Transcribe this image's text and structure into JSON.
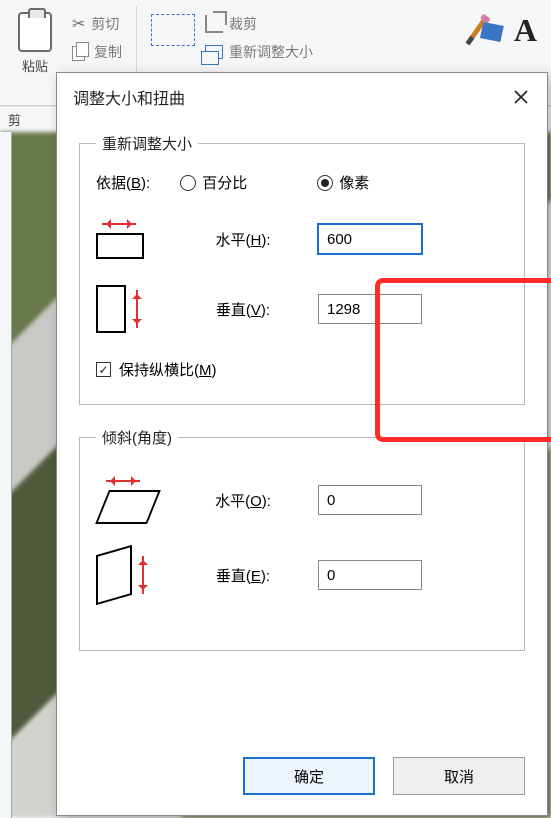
{
  "ribbon": {
    "paste_label": "粘贴",
    "cut_label": "剪切",
    "copy_label": "复制",
    "crop_label": "裁剪",
    "resize_label": "重新调整大小",
    "clipboard_group_caption": "剪"
  },
  "dialog": {
    "title": "调整大小和扭曲",
    "close_glyph": "×",
    "resize": {
      "legend": "重新调整大小",
      "basis_label": "依据",
      "basis_hotkey": "B",
      "percent_label": "百分比",
      "pixel_label": "像素",
      "percent_checked": false,
      "pixel_checked": true,
      "horizontal_label": "水平",
      "horizontal_hotkey": "H",
      "horizontal_value": "600",
      "vertical_label": "垂直",
      "vertical_hotkey": "V",
      "vertical_value": "1298",
      "aspect_label": "保持纵横比",
      "aspect_hotkey": "M",
      "aspect_checked": true
    },
    "skew": {
      "legend": "倾斜(角度)",
      "horizontal_label": "水平",
      "horizontal_hotkey": "O",
      "horizontal_value": "0",
      "vertical_label": "垂直",
      "vertical_hotkey": "E",
      "vertical_value": "0"
    },
    "ok_label": "确定",
    "cancel_label": "取消"
  }
}
